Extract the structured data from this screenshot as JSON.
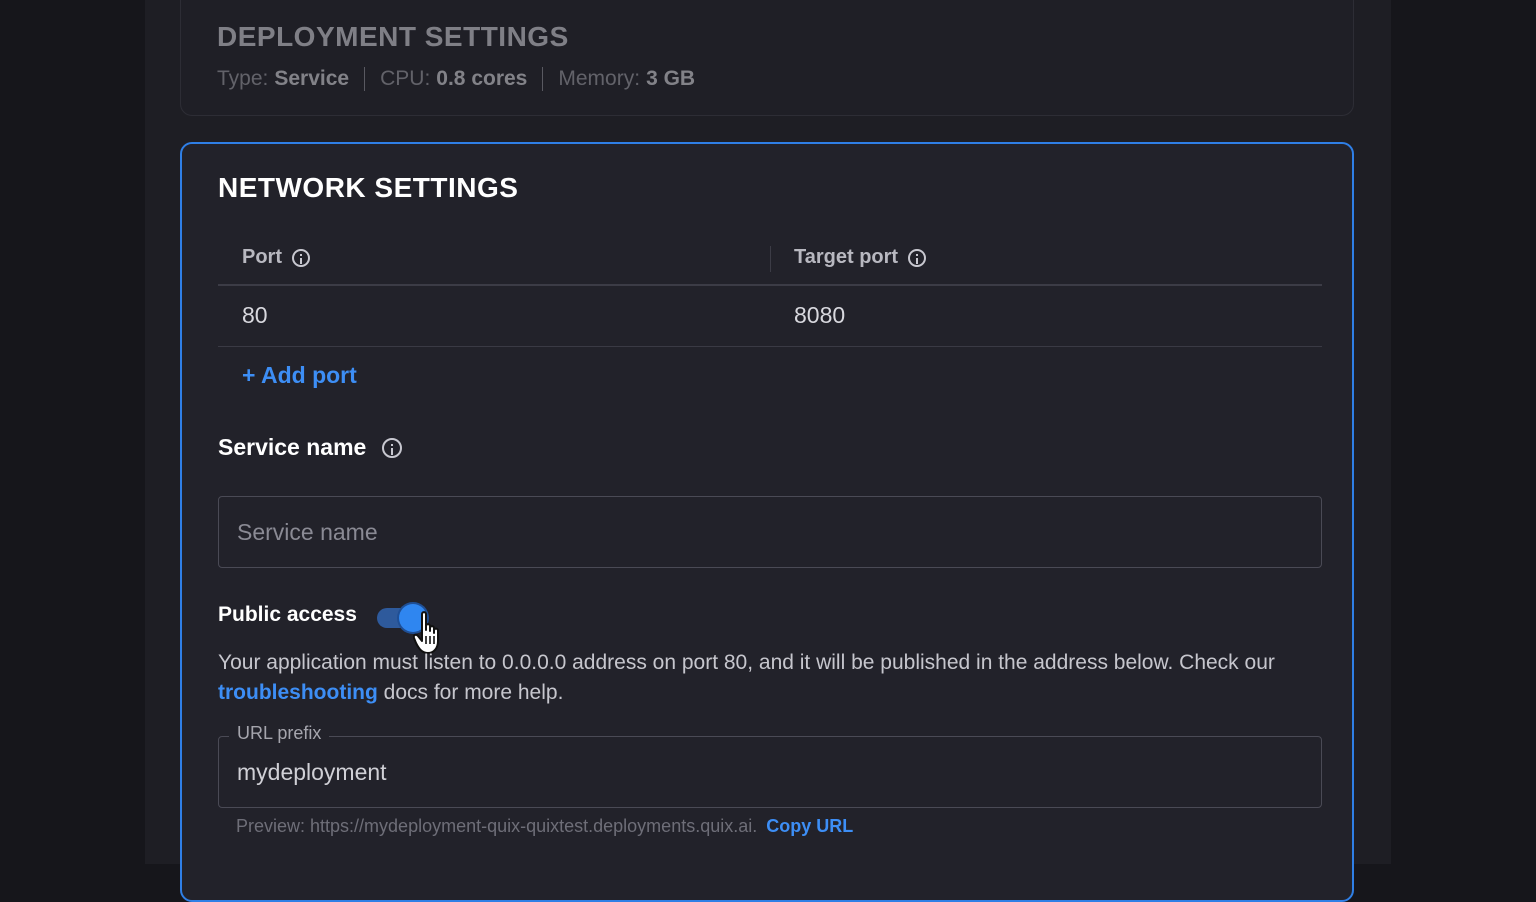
{
  "deployment": {
    "title": "DEPLOYMENT SETTINGS",
    "type_label": "Type:",
    "type_value": "Service",
    "cpu_label": "CPU:",
    "cpu_value": "0.8 cores",
    "memory_label": "Memory:",
    "memory_value": "3 GB"
  },
  "network": {
    "title": "NETWORK SETTINGS",
    "columns": [
      "Port",
      "Target port"
    ],
    "rows": [
      [
        "80",
        "8080"
      ]
    ],
    "add_port": "+ Add port",
    "service_name_label": "Service name",
    "service_name_placeholder": "Service name",
    "public_access_label": "Public access",
    "public_access_enabled": true,
    "help_pre": "Your application must listen to 0.0.0.0 address on port 80, and it will be published in the address below. Check our",
    "help_link": "troubleshooting",
    "help_post": "docs for more help.",
    "url_prefix_label": "URL prefix",
    "url_prefix_value": "mydeployment",
    "preview_text": "Preview: https://mydeployment-quix-quixtest.deployments.quix.ai.",
    "copy_url": "Copy URL"
  },
  "colors": {
    "accent": "#2f7fe6",
    "link": "#3d8ef5"
  }
}
